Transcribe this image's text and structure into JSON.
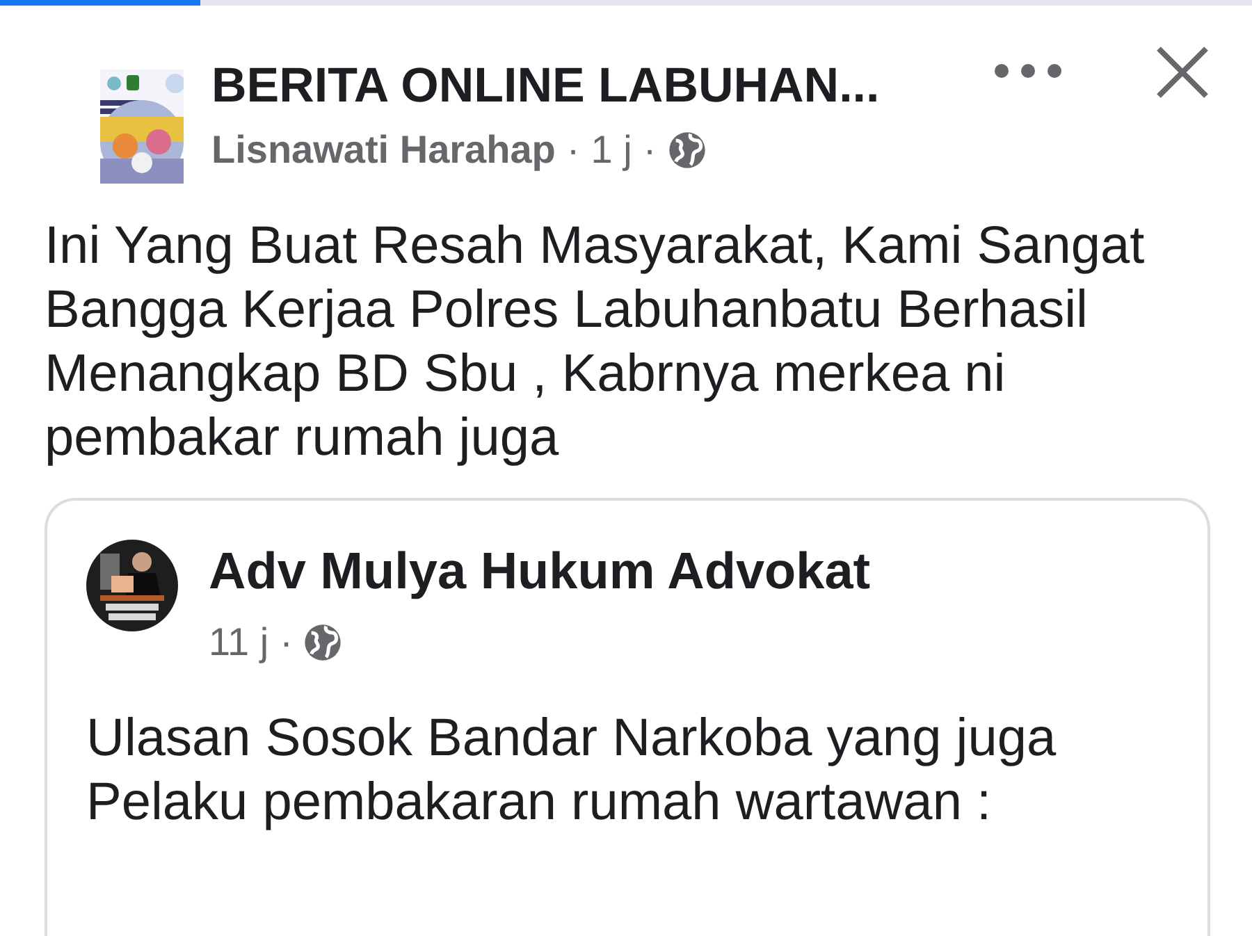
{
  "loading_bar": {
    "level": 0.16
  },
  "post": {
    "group_name": "BERITA ONLINE LABUHAN...",
    "author": "Lisnawati Harahap",
    "separators": [
      "·",
      "·"
    ],
    "time": "1 j",
    "public": true,
    "text": "Ini Yang Buat Resah Masyarakat, Kami Sangat Bangga Kerjaa Polres Labuhanbatu Berhasil Menangkap BD Sbu , Kabrnya merkea ni pembakar rumah juga"
  },
  "shared_post": {
    "author": "Adv Mulya Hukum Advokat",
    "time": "11 j",
    "separator": "·",
    "public": true,
    "text": "Ulasan Sosok Bandar Narkoba yang juga Pelaku pembakaran rumah wartawan :"
  }
}
